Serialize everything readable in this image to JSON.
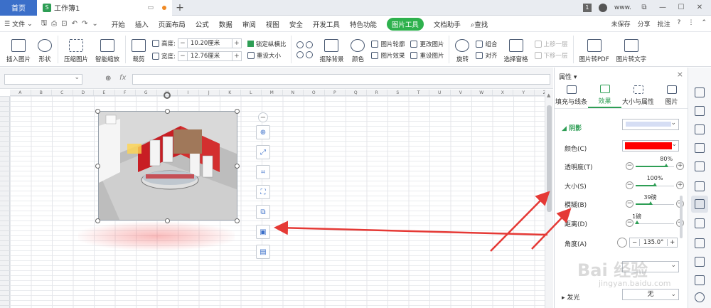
{
  "titlebar": {
    "home_tab": "首页",
    "doc_badge": "S",
    "doc_tab": "工作簿1",
    "num_badge": "1",
    "user": "www."
  },
  "menubar": {
    "file": "文件",
    "items": [
      {
        "label": "开始",
        "active": false
      },
      {
        "label": "插入",
        "active": false
      },
      {
        "label": "页面布局",
        "active": false
      },
      {
        "label": "公式",
        "active": false
      },
      {
        "label": "数据",
        "active": false
      },
      {
        "label": "审阅",
        "active": false
      },
      {
        "label": "视图",
        "active": false
      },
      {
        "label": "安全",
        "active": false
      },
      {
        "label": "开发工具",
        "active": false
      },
      {
        "label": "特色功能",
        "active": false
      },
      {
        "label": "图片工具",
        "active": true
      },
      {
        "label": "文档助手",
        "active": false
      }
    ],
    "search": "查找",
    "right": [
      "未保存",
      "分享",
      "批注"
    ]
  },
  "ribbon": {
    "insert_image": "插入图片",
    "shape": "形状",
    "compress": "压缩图片",
    "smart_zoom": "智能缩放",
    "crop": "裁剪",
    "height_label": "高度:",
    "height_value": "10.20厘米",
    "width_label": "宽度:",
    "width_value": "12.76厘米",
    "lock_ratio": "锁定纵横比",
    "reset_size": "重设大小",
    "remove_bg": "抠除背景",
    "color": "颜色",
    "outline": "图片轮廓",
    "effects": "图片效果",
    "change_image": "更改图片",
    "reset_image": "重设图片",
    "rotate": "旋转",
    "group": "组合",
    "align": "对齐",
    "selection_pane": "选择窗格",
    "bring_forward": "上移一层",
    "send_backward": "下移一层",
    "to_pdf": "图片转PDF",
    "to_text": "图片转文字"
  },
  "formula": {
    "fx": "fx"
  },
  "sheet": {
    "columns": [
      "A",
      "B",
      "C",
      "D",
      "E",
      "F",
      "G",
      "H",
      "I",
      "J",
      "K",
      "L",
      "M",
      "N",
      "O",
      "P",
      "Q",
      "R",
      "S",
      "T",
      "U",
      "V",
      "W",
      "X",
      "Y",
      "Z"
    ]
  },
  "pane": {
    "title": "属性",
    "tabs": [
      {
        "label": "填充与线条",
        "active": false
      },
      {
        "label": "效果",
        "active": true
      },
      {
        "label": "大小与属性",
        "active": false
      },
      {
        "label": "图片",
        "active": false
      }
    ],
    "shadow_section": "阴影",
    "color_label": "颜色(C)",
    "color_value": "#ff0000",
    "transparency_label": "透明度(T)",
    "transparency_value": "80%",
    "transparency_pct": 80,
    "size_label": "大小(S)",
    "size_value": "100%",
    "size_pct": 50,
    "blur_label": "模糊(B)",
    "blur_value": "39磅",
    "blur_pct": 38,
    "distance_label": "距离(D)",
    "distance_value": "1磅",
    "distance_pct": 3,
    "angle_label": "角度(A)",
    "angle_value": "135.0°",
    "glow_section": "发光",
    "glow_value": "无"
  },
  "watermark": {
    "main": "Bai 经验",
    "sub": "jingyan.baidu.com"
  },
  "colors": {
    "accent": "#2eb14d",
    "home_tab": "#3b6fc9",
    "arrow": "#e53935"
  }
}
